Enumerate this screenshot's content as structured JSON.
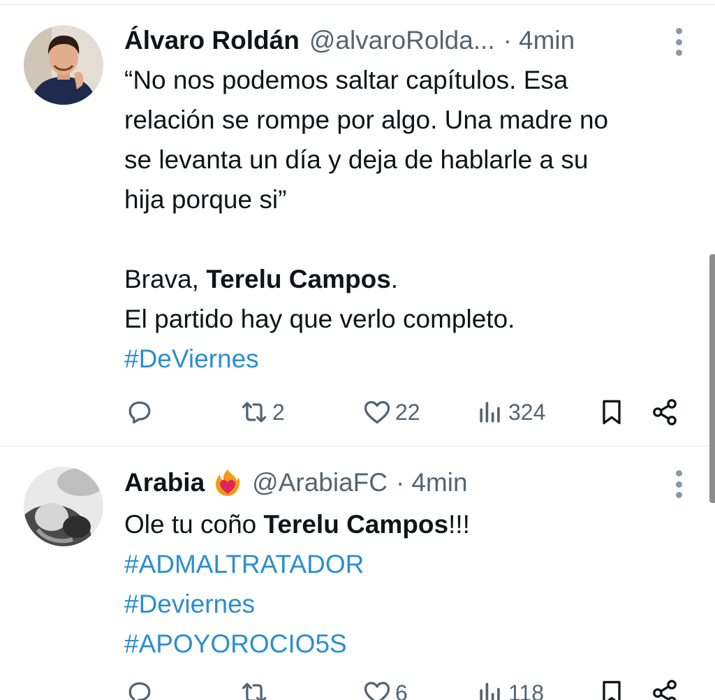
{
  "tweets": [
    {
      "name": "Álvaro Roldán",
      "handle": "@alvaroRolda...",
      "dot": "·",
      "time": "4min",
      "lines": [
        "“No nos podemos saltar capítulos. Esa",
        "relación se rompe por algo. Una madre no",
        "se levanta un día y deja de hablarle a su",
        "hija porque si”"
      ],
      "brava_prefix": "Brava, ",
      "brava_name": "Terelu Campos",
      "brava_suffix": ".",
      "line_match": "El partido hay que verlo completo.",
      "hashtags": [
        "#DeViernes"
      ],
      "stats": {
        "retweets": "2",
        "likes": "22",
        "views": "324"
      }
    },
    {
      "name": "Arabia",
      "badge_icon": "heart-on-fire-emoji",
      "handle": "@ArabiaFC",
      "dot": "·",
      "time": "4min",
      "ole_prefix": "Ole tu coño ",
      "ole_name": "Terelu Campos",
      "ole_suffix": "!!!",
      "hashtags": [
        "#ADMALTRATADOR",
        "#Deviernes",
        "#APOYOROCIO5S"
      ],
      "stats": {
        "retweets": "",
        "likes": "6",
        "views": "118"
      }
    }
  ],
  "colors": {
    "text": "#0f1419",
    "secondary": "#536471",
    "hashtag": "#2b8ed1",
    "divider": "#e1e8ed"
  }
}
